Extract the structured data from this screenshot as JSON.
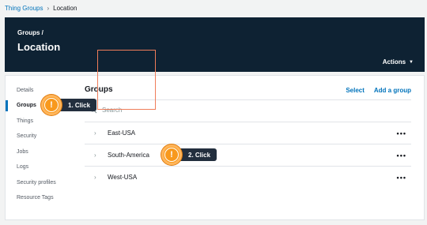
{
  "breadcrumb": {
    "parent": "Thing Groups",
    "separator": "›",
    "current": "Location"
  },
  "header": {
    "crumb": "Groups /",
    "title": "Location",
    "actions_label": "Actions",
    "actions_caret": "▼"
  },
  "sidebar": {
    "items": [
      {
        "label": "Details"
      },
      {
        "label": "Groups"
      },
      {
        "label": "Things"
      },
      {
        "label": "Security"
      },
      {
        "label": "Jobs"
      },
      {
        "label": "Logs"
      },
      {
        "label": "Security profiles"
      },
      {
        "label": "Resource Tags"
      }
    ],
    "active_index": 1
  },
  "main": {
    "title": "Groups",
    "select_label": "Select",
    "add_group_label": "Add a group",
    "search_placeholder": "Search",
    "rows": [
      {
        "name": "East-USA",
        "more": "•••"
      },
      {
        "name": "South-America",
        "more": "•••"
      },
      {
        "name": "West-USA",
        "more": "•••"
      }
    ]
  },
  "callouts": [
    {
      "badge": "!",
      "text": "1. Click"
    },
    {
      "badge": "!",
      "text": "2. Click"
    }
  ],
  "colors": {
    "accent": "#0073bb",
    "header_bg": "#0e2233",
    "callout_badge": "#f8991d",
    "callout_bg": "#232f3e",
    "highlight_border": "#ef7d5a"
  },
  "icons": {
    "search": "search-icon",
    "chevron": "chevron-right-icon",
    "more": "more-options-icon",
    "alert": "alert-icon"
  }
}
